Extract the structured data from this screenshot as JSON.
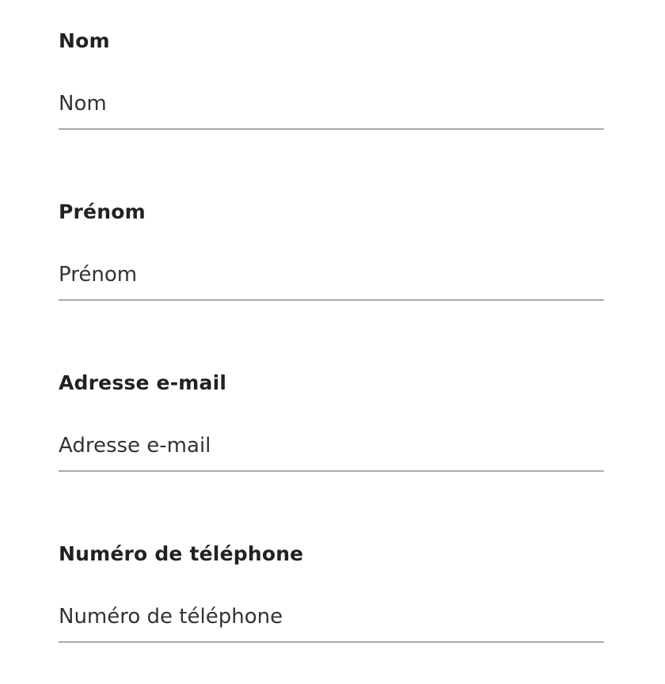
{
  "form": {
    "fields": [
      {
        "label": "Nom",
        "placeholder": "Nom",
        "value": ""
      },
      {
        "label": "Prénom",
        "placeholder": "Prénom",
        "value": ""
      },
      {
        "label": "Adresse e-mail",
        "placeholder": "Adresse e-mail",
        "value": ""
      },
      {
        "label": "Numéro de téléphone",
        "placeholder": "Numéro de téléphone",
        "value": ""
      }
    ]
  },
  "colors": {
    "label": "#222222",
    "placeholder": "#333333",
    "underline": "#a9a9a9"
  }
}
